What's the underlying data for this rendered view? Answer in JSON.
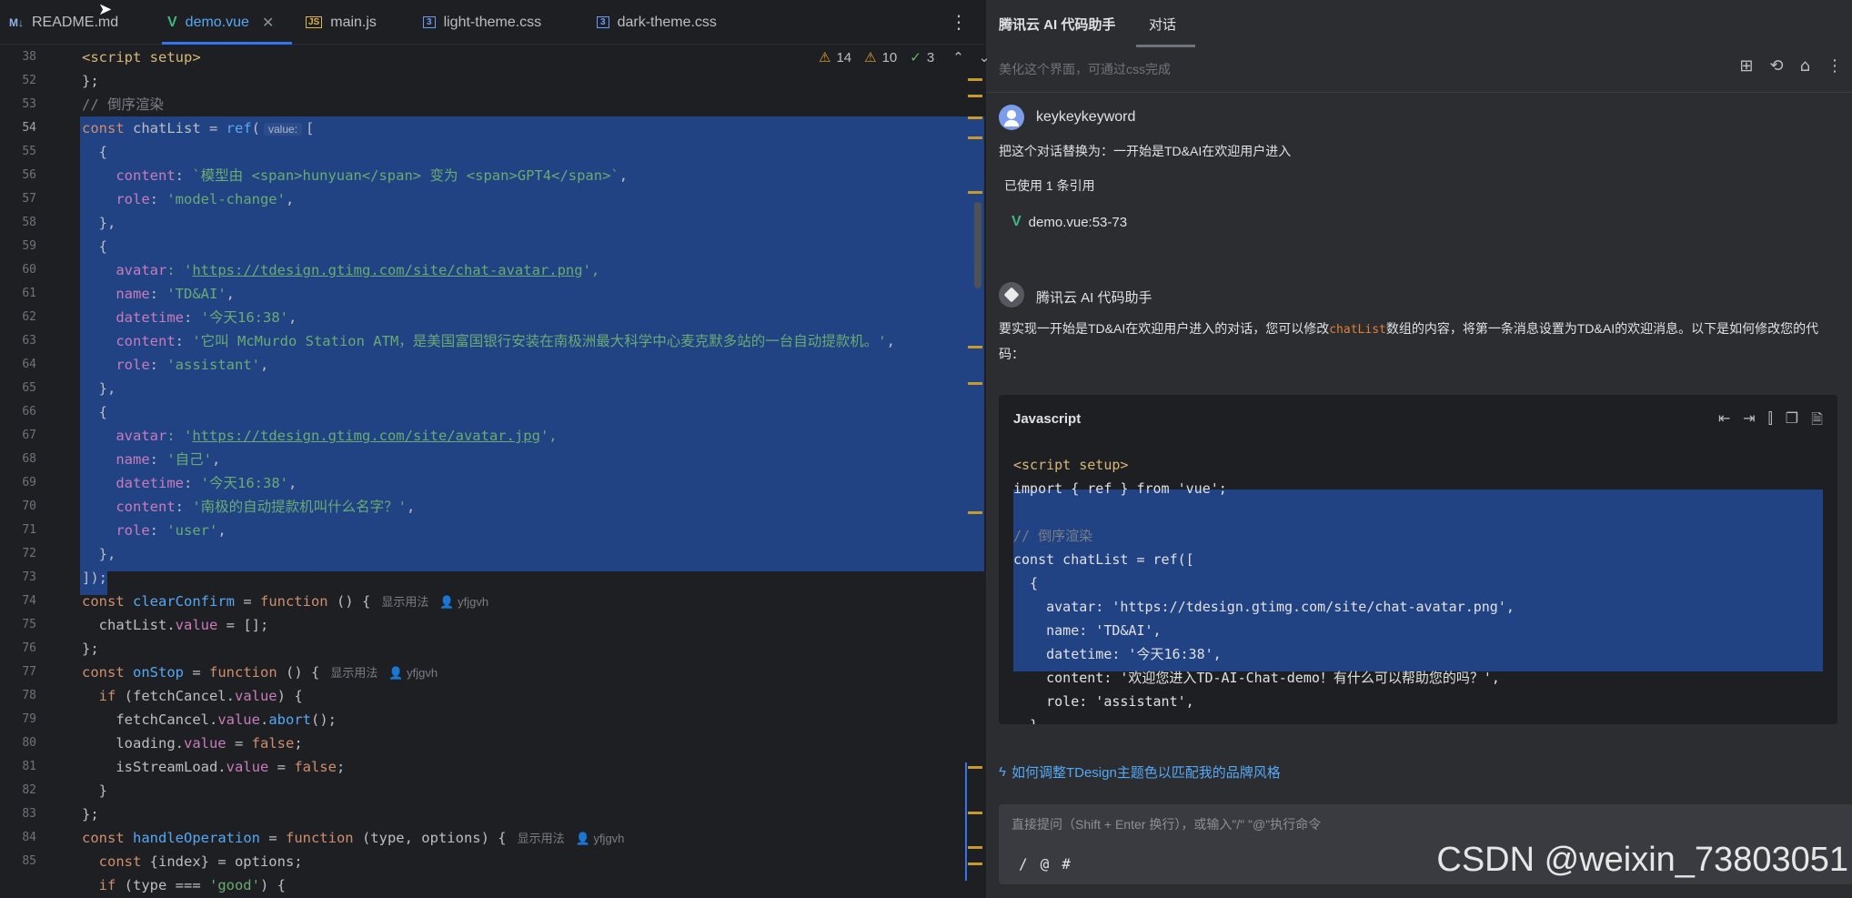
{
  "tabs": [
    {
      "icon": "M↓",
      "label": "README.md",
      "active": false
    },
    {
      "icon": "V",
      "label": "demo.vue",
      "active": true
    },
    {
      "icon": "JS",
      "label": "main.js",
      "active": false
    },
    {
      "icon": "3",
      "label": "light-theme.css",
      "active": false
    },
    {
      "icon": "3",
      "label": "dark-theme.css",
      "active": false
    }
  ],
  "inspections": {
    "warnings_a": "14",
    "warnings_b": "10",
    "ok": "3"
  },
  "line_numbers": [
    "38",
    "52",
    "53",
    "54",
    "55",
    "56",
    "57",
    "58",
    "59",
    "60",
    "61",
    "62",
    "63",
    "64",
    "65",
    "66",
    "67",
    "68",
    "69",
    "70",
    "71",
    "72",
    "73",
    "74",
    "75",
    "76",
    "77",
    "78",
    "79",
    "80",
    "81",
    "82",
    "83",
    "84",
    "85"
  ],
  "code": {
    "l38": "<script setup>",
    "l52": "};",
    "l53": "// 倒序渲染",
    "l54_a": "const",
    "l54_b": " chatList = ",
    "l54_c": "ref",
    "l54_d": "(",
    "l54_hint": "value:",
    "l54_e": "[",
    "l55": "  {",
    "l56_a": "    content",
    "l56_b": ": ",
    "l56_c": "`模型由 <span>hunyuan</span> 变为 <span>GPT4</span>`",
    "l56_d": ",",
    "l57_a": "    role",
    "l57_b": ": ",
    "l57_c": "'model-change'",
    "l57_d": ",",
    "l58": "  },",
    "l59": "  {",
    "l60_a": "    avatar",
    "l60_b": ": '",
    "l60_c": "https://tdesign.gtimg.com/site/chat-avatar.png",
    "l60_d": "',",
    "l61_a": "    name",
    "l61_b": ": ",
    "l61_c": "'TD&AI'",
    "l61_d": ",",
    "l62_a": "    datetime",
    "l62_b": ": ",
    "l62_c": "'今天16:38'",
    "l62_d": ",",
    "l63_a": "    content",
    "l63_b": ": ",
    "l63_c": "'它叫 McMurdo Station ATM，是美国富国银行安装在南极洲最大科学中心麦克默多站的一台自动提款机。'",
    "l63_d": ",",
    "l64_a": "    role",
    "l64_b": ": ",
    "l64_c": "'assistant'",
    "l64_d": ",",
    "l65": "  },",
    "l66": "  {",
    "l67_a": "    avatar",
    "l67_b": ": '",
    "l67_c": "https://tdesign.gtimg.com/site/avatar.jpg",
    "l67_d": "',",
    "l68_a": "    name",
    "l68_b": ": ",
    "l68_c": "'自己'",
    "l68_d": ",",
    "l69_a": "    datetime",
    "l69_b": ": ",
    "l69_c": "'今天16:38'",
    "l69_d": ",",
    "l70_a": "    content",
    "l70_b": ": ",
    "l70_c": "'南极的自动提款机叫什么名字？'",
    "l70_d": ",",
    "l71_a": "    role",
    "l71_b": ": ",
    "l71_c": "'user'",
    "l71_d": ",",
    "l72": "  },",
    "l73": "]);",
    "l74_a": "const ",
    "l74_b": "clearConfirm",
    "l74_c": " = ",
    "l74_d": "function",
    "l74_e": " () {",
    "l74_hint": "显示用法",
    "l74_author": "👤 yfjgvh",
    "l75_a": "  chatList.",
    "l75_b": "value",
    "l75_c": " = [];",
    "l76": "};",
    "l77_a": "const ",
    "l77_b": "onStop",
    "l77_c": " = ",
    "l77_d": "function",
    "l77_e": " () {",
    "l77_hint": "显示用法",
    "l77_author": "👤 yfjgvh",
    "l78_a": "  if",
    "l78_b": " (fetchCancel.",
    "l78_c": "value",
    "l78_d": ") {",
    "l79_a": "    fetchCancel.",
    "l79_b": "value",
    "l79_c": ".",
    "l79_d": "abort",
    "l79_e": "();",
    "l80_a": "    loading.",
    "l80_b": "value",
    "l80_c": " = ",
    "l80_d": "false",
    "l80_e": ";",
    "l81_a": "    isStreamLoad.",
    "l81_b": "value",
    "l81_c": " = ",
    "l81_d": "false",
    "l81_e": ";",
    "l82": "  }",
    "l83": "};",
    "l84_a": "const ",
    "l84_b": "handleOperation",
    "l84_c": " = ",
    "l84_d": "function",
    "l84_e": " (type, options) {",
    "l84_hint": "显示用法",
    "l84_author": "👤 yfjgvh",
    "l85_a": "  const",
    "l85_b": " {index} = options;",
    "l86_a": "  if",
    "l86_b": " (type === ",
    "l86_c": "'good'",
    "l86_d": ") {"
  },
  "ai": {
    "title": "腾讯云 AI 代码助手",
    "tab": "对话",
    "subtitle": "美化这个界面，可通过css完成",
    "user_name": "keykeykeyword",
    "user_message": "把这个对话替换为：一开始是TD&AI在欢迎用户进入",
    "ref_used": "已使用 1 条引用",
    "ref_file": "demo.vue:53-73",
    "bot_name": "腾讯云 AI 代码助手",
    "bot_msg_a": "要实现一开始是TD&AI在欢迎用户进入的对话，您可以修改",
    "bot_msg_code": "chatList",
    "bot_msg_b": "数组的内容，将第一条消息设置为TD&AI的欢迎消息。以下是如何修改您的代码：",
    "code_lang": "Javascript",
    "code_lines": [
      "<script setup>",
      "import { ref } from 'vue';",
      "",
      "// 倒序渲染",
      "const chatList = ref([",
      "  {",
      "    avatar: 'https://tdesign.gtimg.com/site/chat-avatar.png',",
      "    name: 'TD&AI',",
      "    datetime: '今天16:38',",
      "    content: '欢迎您进入TD-AI-Chat-demo！有什么可以帮助您的吗？',",
      "    role: 'assistant',",
      "  },"
    ],
    "suggestion": "如何调整TDesign主题色以匹配我的品牌风格",
    "input_placeholder": "直接提问（Shift + Enter 换行），或输入\"/\" \"@\"执行命令",
    "input_tools": [
      "/",
      "@",
      "#"
    ]
  },
  "watermark": "CSDN @weixin_73803051",
  "colors": {
    "selection": "#214283",
    "accent": "#3574f0",
    "warning": "#e0a22c",
    "vue": "#41b883"
  }
}
